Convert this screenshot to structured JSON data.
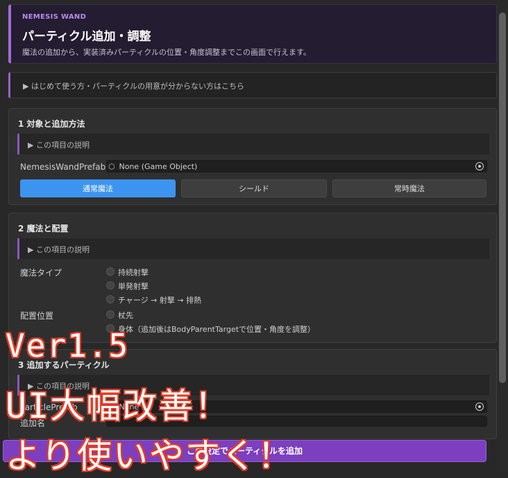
{
  "header": {
    "brand": "NEMESIS WAND",
    "title": "パーティクル追加・調整",
    "subtitle": "魔法の追加から、実装済みパーティクルの位置・角度調整までこの画面で行えます。",
    "accent": "#a06ad8"
  },
  "guide": {
    "label": "▶ はじめて使う方・パーティクルの用意が分からない方はこちら"
  },
  "section1": {
    "title": "1 対象と追加方法",
    "help": "▶ この項目の説明",
    "prefab_label": "NemesisWandPrefab",
    "prefab_value": "None (Game Object)",
    "buttons": [
      "通常魔法",
      "シールド",
      "常時魔法"
    ],
    "active_color": "#3d94f0"
  },
  "section2": {
    "title": "2 魔法と配置",
    "help": "▶ この項目の説明",
    "magic_type_label": "魔法タイプ",
    "magic_types": [
      "持続射撃",
      "単発射撃",
      "チャージ → 射撃 → 排熱"
    ],
    "placement_label": "配置位置",
    "placements": [
      "杖先",
      "身体（追加後はBodyParentTargetで位置・角度を調整）"
    ]
  },
  "section3": {
    "title": "3 追加するパーティクル",
    "help": "▶ この項目の説明",
    "particle_label": "ParticlePrefab",
    "particle_value": "None",
    "name_label": "追加名"
  },
  "add_button": {
    "label": "この設定でパーティクルを追加",
    "color": "#7c3fbf"
  },
  "overlay": {
    "line1": "Ver1.5",
    "line2": "UI大幅改善！",
    "line3": "より使いやすく！",
    "color": "#e83a24"
  }
}
